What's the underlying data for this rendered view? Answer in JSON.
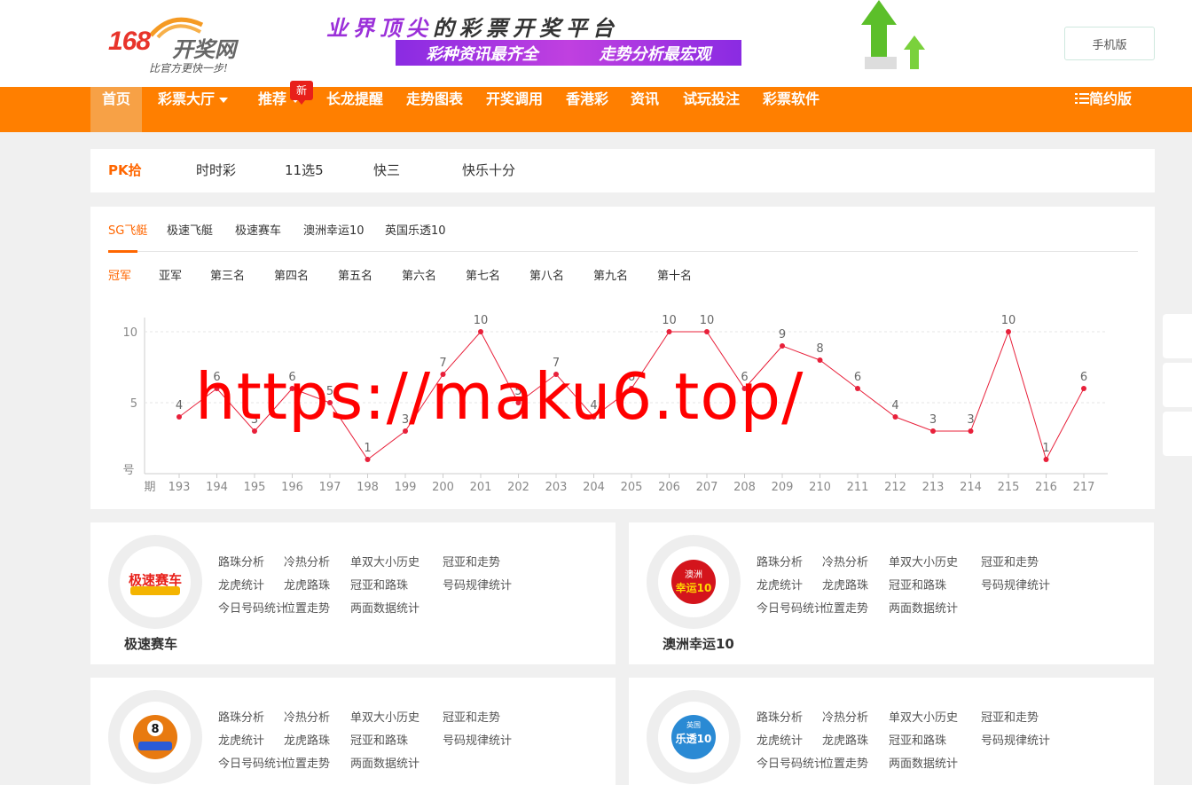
{
  "header": {
    "logo_num": "168",
    "logo_name": "开奖网",
    "logo_slogan": "比官方更快一步!",
    "banner_a": "业界顶尖",
    "banner_b": "的彩票开奖平台",
    "banner_sub1": "彩种资讯最齐全",
    "banner_sub2": "走势分析最宏观",
    "mobile_label": "手机版"
  },
  "nav": {
    "items": [
      {
        "label": "首页"
      },
      {
        "label": "彩票大厅"
      },
      {
        "label": "推荐"
      },
      {
        "label": "长龙提醒"
      },
      {
        "label": "走势图表"
      },
      {
        "label": "开奖调用"
      },
      {
        "label": "香港彩"
      },
      {
        "label": "资讯"
      },
      {
        "label": "试玩投注"
      },
      {
        "label": "彩票软件"
      }
    ],
    "new_badge": "新",
    "simple_label": "简约版"
  },
  "lottery_tabs": [
    "PK拾",
    "时时彩",
    "11选5",
    "快三",
    "快乐十分"
  ],
  "game_tabs": [
    "SG飞艇",
    "极速飞艇",
    "极速赛车",
    "澳洲幸运10",
    "英国乐透10"
  ],
  "rank_tabs": [
    "冠军",
    "亚军",
    "第三名",
    "第四名",
    "第五名",
    "第六名",
    "第七名",
    "第八名",
    "第九名",
    "第十名"
  ],
  "chart_data": {
    "type": "line",
    "y_unit": "号",
    "x_unit": "期",
    "x": [
      "193",
      "194",
      "195",
      "196",
      "197",
      "198",
      "199",
      "200",
      "201",
      "202",
      "203",
      "204",
      "205",
      "206",
      "207",
      "208",
      "209",
      "210",
      "211",
      "212",
      "213",
      "214",
      "215",
      "216",
      "217"
    ],
    "values": [
      4,
      6,
      3,
      6,
      5,
      1,
      3,
      7,
      10,
      5,
      7,
      4,
      6,
      10,
      10,
      6,
      9,
      8,
      6,
      4,
      3,
      3,
      10,
      1,
      6
    ],
    "y_ticks": [
      "10",
      "5"
    ],
    "ylim": [
      0,
      10
    ],
    "color": "#e8203a"
  },
  "watermark": "https://maku6.top/",
  "cards": [
    {
      "title": "极速赛车",
      "logo_text": "极速赛车",
      "logo_color": "#e8201a",
      "links": [
        [
          "路珠分析",
          "冷热分析",
          "单双大小历史",
          "冠亚和走势"
        ],
        [
          "龙虎统计",
          "龙虎路珠",
          "冠亚和路珠",
          "号码规律统计"
        ],
        [
          "今日号码统计",
          "位置走势",
          "两面数据统计"
        ]
      ]
    },
    {
      "title": "澳洲幸运10",
      "logo_text": "幸运10",
      "logo_color": "#d4141c",
      "links": [
        [
          "路珠分析",
          "冷热分析",
          "单双大小历史",
          "冠亚和走势"
        ],
        [
          "龙虎统计",
          "龙虎路珠",
          "冠亚和路珠",
          "号码规律统计"
        ],
        [
          "今日号码统计",
          "位置走势",
          "两面数据统计"
        ]
      ]
    },
    {
      "title": "",
      "logo_text": "8",
      "logo_color": "#e87a10",
      "links": [
        [
          "路珠分析",
          "冷热分析",
          "单双大小历史",
          "冠亚和走势"
        ],
        [
          "龙虎统计",
          "龙虎路珠",
          "冠亚和路珠",
          "号码规律统计"
        ],
        [
          "今日号码统计",
          "位置走势",
          "两面数据统计"
        ]
      ]
    },
    {
      "title": "",
      "logo_text": "乐透10",
      "logo_color": "#2a8ad4",
      "links": [
        [
          "路珠分析",
          "冷热分析",
          "单双大小历史",
          "冠亚和走势"
        ],
        [
          "龙虎统计",
          "龙虎路珠",
          "冠亚和路珠",
          "号码规律统计"
        ],
        [
          "今日号码统计",
          "位置走势",
          "两面数据统计"
        ]
      ]
    }
  ]
}
